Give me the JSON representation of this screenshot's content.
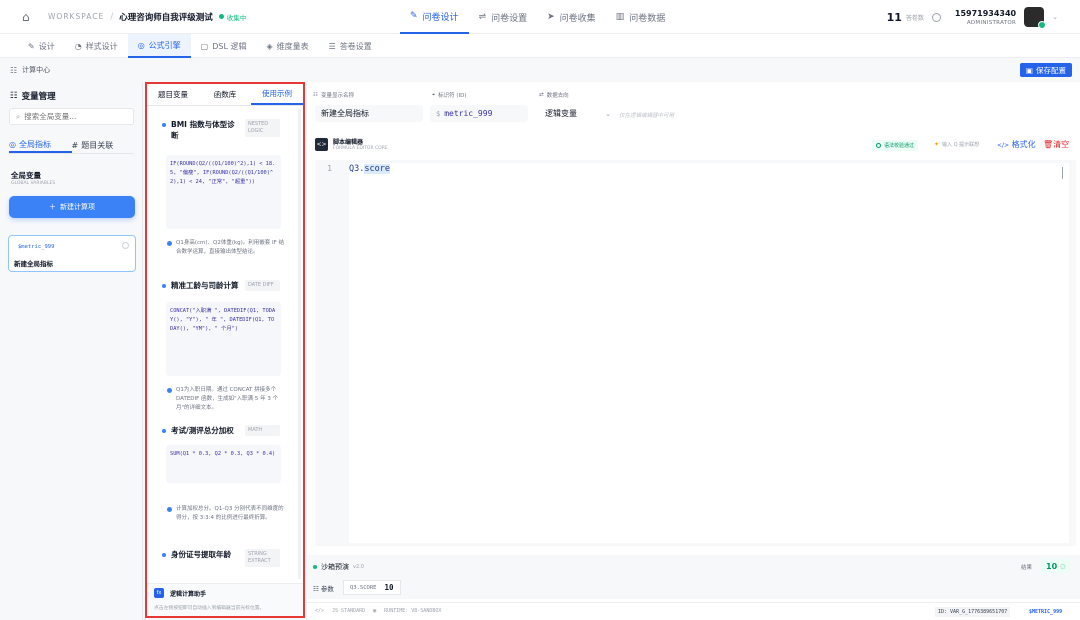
{
  "header": {
    "workspace": "WORKSPACE",
    "project": "心理咨询师自我评级测试",
    "status": "收集中",
    "nav": [
      {
        "label": "问卷设计",
        "icon": "pen-icon"
      },
      {
        "label": "问卷设置",
        "icon": "sliders-icon"
      },
      {
        "label": "问卷收集",
        "icon": "send-icon"
      },
      {
        "label": "问卷数据",
        "icon": "chart-icon"
      }
    ],
    "count": "11",
    "count_label": "答卷数",
    "phone": "15971934340",
    "role": "ADMINISTRATOR"
  },
  "subnav": [
    {
      "label": "设计",
      "icon": "edit-icon"
    },
    {
      "label": "样式设计",
      "icon": "palette-icon"
    },
    {
      "label": "公式引擎",
      "icon": "formula-icon"
    },
    {
      "label": "DSL 逻辑",
      "icon": "code-icon"
    },
    {
      "label": "维度量表",
      "icon": "layers-icon"
    },
    {
      "label": "答卷设置",
      "icon": "list-icon"
    }
  ],
  "breadcrumb": "计算中心",
  "save_label": "保存配置",
  "left": {
    "title": "变量管理",
    "search_placeholder": "搜索全局变量...",
    "tab_global": "全局指标",
    "tab_relation": "题目关联",
    "global_title": "全局变量",
    "global_sub": "GLOBAL VARIABLES",
    "new_button": "新建计算项",
    "card_key": "$metric_999",
    "card_name": "新建全局指标"
  },
  "middle": {
    "tabs": [
      "题目变量",
      "函数库",
      "使用示例"
    ],
    "examples": [
      {
        "name": "BMI 指数与体型诊断",
        "tag": "NESTED LOGIC",
        "code": "IF(ROUND(Q2/((Q1/100)^2),1) < 18.5, \"偏瘦\", IF(ROUND(Q2/((Q1/100)^2),1) < 24, \"正常\", \"超重\"))",
        "desc": "Q1身高(cm)、Q2体重(kg)。利用嵌套 IF 结合数学运算，直接输出体型结论。"
      },
      {
        "name": "精准工龄与司龄计算",
        "tag": "DATE DIFF",
        "code": "CONCAT(\"入职满 \", DATEDIF(Q1, TODAY(), \"Y\"), \" 年 \", DATEDIF(Q1, TODAY(), \"YM\"), \" 个月\")",
        "desc": "Q1为入职日期。通过 CONCAT 拼接多个 DATEDIF 函数，生成如\"入职满 5 年 3 个月\"的详细文本。"
      },
      {
        "name": "考试/测评总分加权",
        "tag": "MATH",
        "code": "SUM(Q1 * 0.3, Q2 * 0.3, Q3 * 0.4)",
        "desc": "计算加权总分。Q1-Q3 分别代表不同维度的得分，按 3:3:4 的比例进行最终折算。"
      },
      {
        "name": "身份证号提取年龄",
        "tag": "STRING EXTRACT",
        "code": "",
        "desc": ""
      }
    ],
    "assistant_title": "逻辑计算助手",
    "assistant_hint": "点击左侧按钮即可自动插入到编辑器当前光标位置。"
  },
  "right": {
    "label_name": "变量显示名称",
    "label_id": "标识符 (ID)",
    "label_dir": "数据去向",
    "name_value": "新建全局指标",
    "id_prefix": "$",
    "id_value": "metric_999",
    "dir_value": "逻辑变量",
    "dir_hint": "仅在逻辑编辑器中可用",
    "editor_title": "脚本编辑器",
    "editor_sub": "FORMULA EDITOR CORE",
    "syntax_ok": "语法校验通过",
    "hint_q": "输入 Q 提示联想",
    "format_label": "格式化",
    "clear_label": "清空",
    "line_no": "1",
    "code_prefix": "Q3.",
    "code_selected": "score",
    "sandbox_label": "沙箱预演",
    "sandbox_version": "v2.0",
    "result_label": "结果",
    "result_value": "10",
    "param_label": "参数",
    "param_key": "Q3.SCORE",
    "param_value": "10",
    "foot_js": "JS STANDARD",
    "foot_runtime": "RUNTIME: V8-SANDBOX",
    "foot_id": "ID: VAR_G_1776389651707",
    "foot_key": "$METRIC_999"
  }
}
